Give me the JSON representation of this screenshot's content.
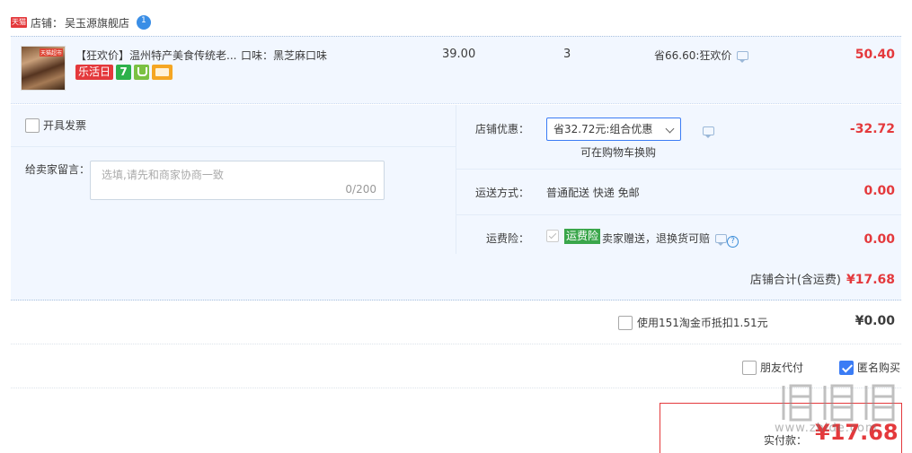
{
  "shop": {
    "platform_badge": "天猫",
    "label": "店铺：",
    "name": "吴玉源旗舰店"
  },
  "item": {
    "thumb_tag": "天猫超市",
    "title": "【狂欢价】温州特产美食传统老...",
    "sku": "口味：黑芝麻口味",
    "badge_lhr": "乐活日",
    "badge_seven": "7",
    "unit_price": "39.00",
    "quantity": "3",
    "discount_note": "省66.60:狂欢价",
    "total": "50.40"
  },
  "options": {
    "invoice_label": "开具发票",
    "memo_label": "给卖家留言：",
    "memo_placeholder": "选填,请先和商家协商一致",
    "memo_count": "0/200",
    "store_discount_label": "店铺优惠：",
    "store_discount_selected": "省32.72元:组合优惠",
    "store_discount_note": "可在购物车换购",
    "store_discount_value": "-32.72",
    "shipping_label": "运送方式：",
    "shipping_method": "普通配送 快递 免邮",
    "shipping_value": "0.00",
    "insurance_label": "运费险：",
    "insurance_badge": "运费险",
    "insurance_text": "卖家赠送，退换货可赔",
    "insurance_value": "0.00",
    "store_total_label": "店铺合计(含运费)",
    "store_total_value": "¥17.68"
  },
  "coins": {
    "label": "使用151淘金币抵扣1.51元",
    "value": "¥0.00"
  },
  "pay_options": {
    "friend_pay": "朋友代付",
    "anonymous_buy": "匿名购买"
  },
  "final": {
    "label": "实付款：",
    "amount": "¥17.68"
  },
  "watermark": {
    "text": "www.zhide.com"
  },
  "colors": {
    "accent_red": "#e4393c",
    "panel_bg": "#f2f7ff",
    "checkbox_blue": "#3b7cf5",
    "insurance_green": "#3aa64b"
  }
}
